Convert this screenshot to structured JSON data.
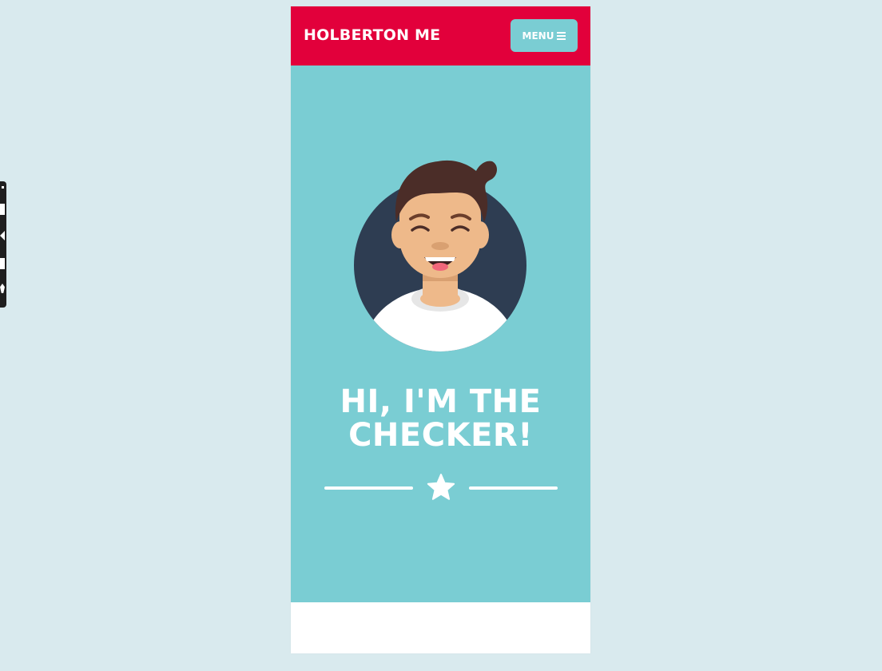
{
  "navbar": {
    "brand": "HOLBERTON ME",
    "menu_label": "MENU",
    "menu_icon": "hamburger-icon",
    "background_color": "#e2003b",
    "menu_button_color": "#7acdd3"
  },
  "hero": {
    "title_line1": "HI, I'M THE",
    "title_line2": "CHECKER!",
    "background_color": "#7acdd3",
    "avatar": "avatar-illustration",
    "divider_icon": "star-icon"
  },
  "page": {
    "background_color": "#d9eaee"
  }
}
